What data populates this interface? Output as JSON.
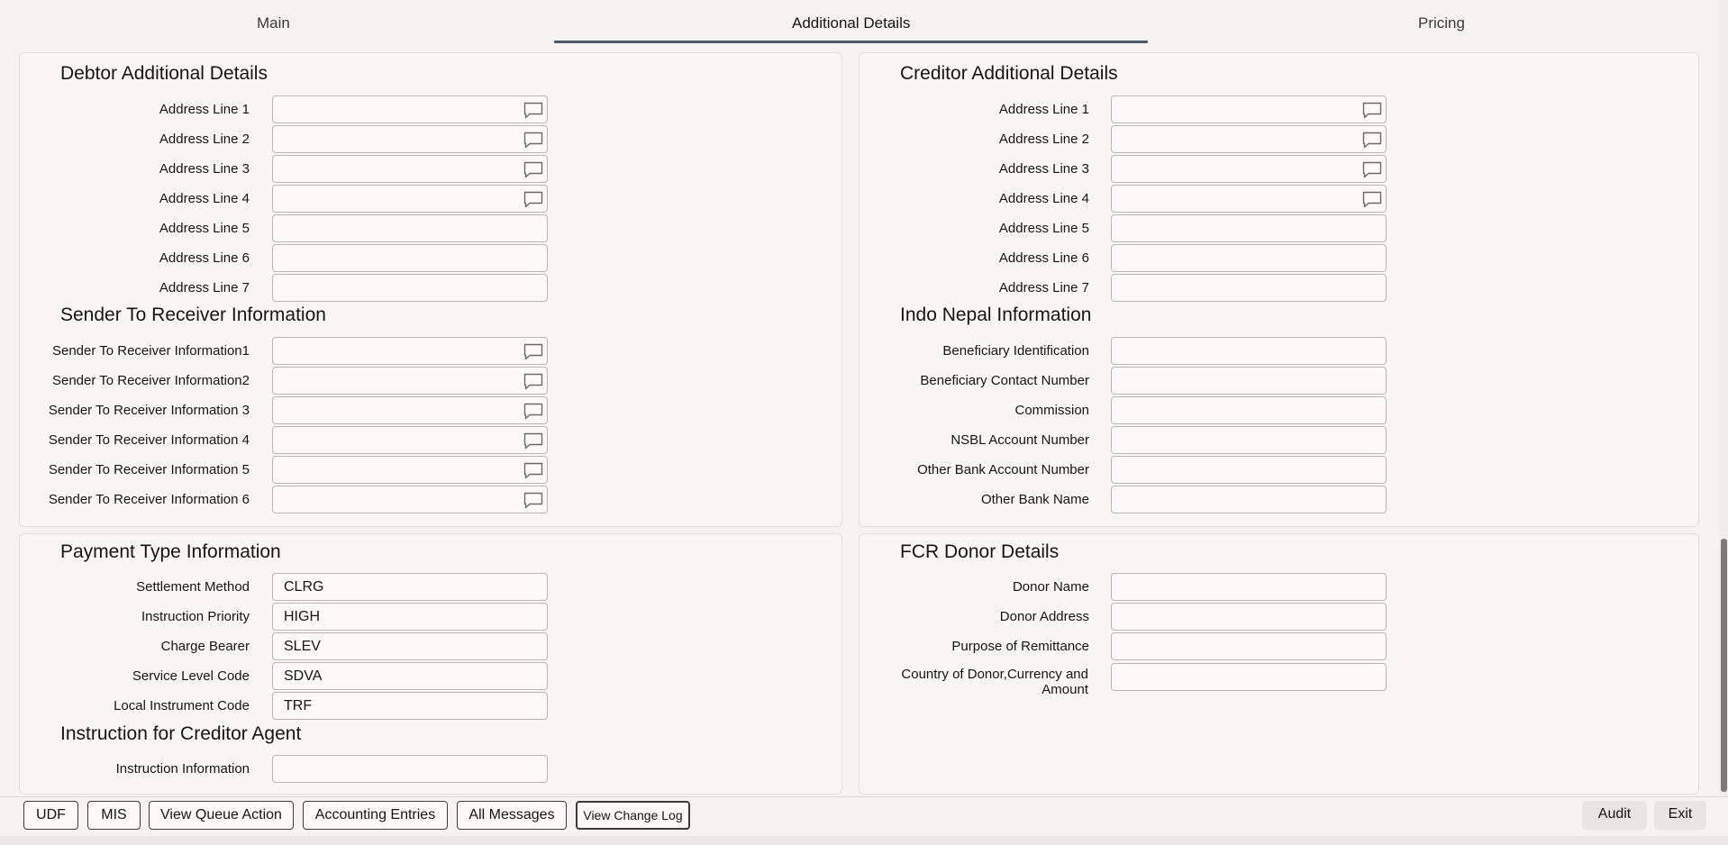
{
  "tabs": {
    "main": "Main",
    "additional": "Additional Details",
    "pricing": "Pricing"
  },
  "debtor": {
    "title": "Debtor Additional Details",
    "fields": [
      {
        "label": "Address Line 1",
        "value": ""
      },
      {
        "label": "Address Line 2",
        "value": ""
      },
      {
        "label": "Address Line 3",
        "value": ""
      },
      {
        "label": "Address Line 4",
        "value": ""
      },
      {
        "label": "Address Line 5",
        "value": ""
      },
      {
        "label": "Address Line 6",
        "value": ""
      },
      {
        "label": "Address Line 7",
        "value": ""
      }
    ]
  },
  "creditor": {
    "title": "Creditor Additional Details",
    "fields": [
      {
        "label": "Address Line 1",
        "value": ""
      },
      {
        "label": "Address Line 2",
        "value": ""
      },
      {
        "label": "Address Line 3",
        "value": ""
      },
      {
        "label": "Address Line 4",
        "value": ""
      },
      {
        "label": "Address Line 5",
        "value": ""
      },
      {
        "label": "Address Line 6",
        "value": ""
      },
      {
        "label": "Address Line 7",
        "value": ""
      }
    ]
  },
  "sender": {
    "title": "Sender To Receiver Information",
    "fields": [
      {
        "label": "Sender To Receiver Information1",
        "value": ""
      },
      {
        "label": "Sender To Receiver Information2",
        "value": ""
      },
      {
        "label": "Sender To Receiver Information 3",
        "value": ""
      },
      {
        "label": "Sender To Receiver Information 4",
        "value": ""
      },
      {
        "label": "Sender To Receiver Information 5",
        "value": ""
      },
      {
        "label": "Sender To Receiver Information 6",
        "value": ""
      }
    ]
  },
  "indo_nepal": {
    "title": "Indo Nepal Information",
    "fields": [
      {
        "label": "Beneficiary Identification",
        "value": ""
      },
      {
        "label": "Beneficiary Contact Number",
        "value": ""
      },
      {
        "label": "Commission",
        "value": ""
      },
      {
        "label": "NSBL Account Number",
        "value": ""
      },
      {
        "label": "Other Bank Account Number",
        "value": ""
      },
      {
        "label": "Other Bank Name",
        "value": ""
      }
    ]
  },
  "payment_type": {
    "title": "Payment Type Information",
    "fields": [
      {
        "label": "Settlement Method",
        "value": "CLRG"
      },
      {
        "label": "Instruction Priority",
        "value": "HIGH"
      },
      {
        "label": "Charge Bearer",
        "value": "SLEV"
      },
      {
        "label": "Service Level Code",
        "value": "SDVA"
      },
      {
        "label": "Local Instrument Code",
        "value": "TRF"
      }
    ]
  },
  "creditor_agent": {
    "title": "Instruction for Creditor Agent",
    "fields": [
      {
        "label": "Instruction Information",
        "value": ""
      }
    ]
  },
  "fcr_donor": {
    "title": "FCR Donor Details",
    "fields": [
      {
        "label": "Donor Name",
        "value": ""
      },
      {
        "label": "Donor Address",
        "value": ""
      },
      {
        "label": "Purpose of Remittance",
        "value": ""
      },
      {
        "label_line1": "Country of Donor,Currency and",
        "label_line2": "Amount",
        "value": ""
      }
    ]
  },
  "footer": {
    "udf": "UDF",
    "mis": "MIS",
    "view_queue_action": "View Queue Action",
    "accounting_entries": "Accounting Entries",
    "all_messages": "All Messages",
    "view_change_log": "View Change Log",
    "audit": "Audit",
    "exit": "Exit"
  },
  "icons": {
    "message": "message-icon"
  }
}
